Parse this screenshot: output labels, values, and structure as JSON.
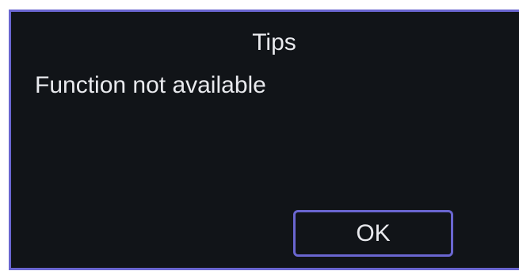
{
  "dialog": {
    "title": "Tips",
    "message": "Function not available",
    "ok_label": "OK"
  },
  "colors": {
    "dialog_background": "#111418",
    "border_accent": "#6a66d0",
    "text": "#e9eaee"
  }
}
